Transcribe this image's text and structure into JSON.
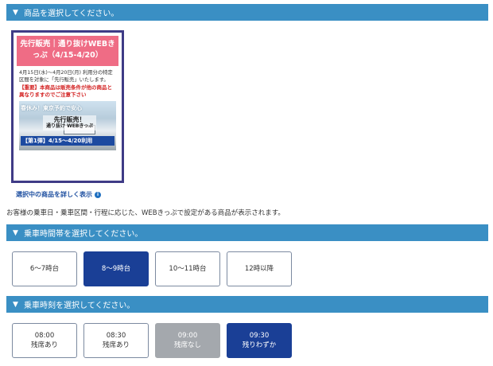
{
  "sections": {
    "product": "商品を選択してください。",
    "time_band": "乗車時間帯を選択してください。",
    "time": "乗車時刻を選択してください。"
  },
  "product_card": {
    "title": "先行販売｜通り抜けWEBきっぷ（4/15-4/20）",
    "description": "4月15日(水)～4月20日(月) 利用分の特定区間を対象に「先行販売」いたします。",
    "note": "【重要】本商品は販売条件が他の商品と異なりますのでご注意下さい",
    "image_overlay_top": "春休み！東京予約で安心",
    "image_overlay_main": "先行販売！",
    "image_overlay_sub": "通り抜け WEBきっぷ",
    "image_overlay_bottom": "【第1弾】4/15～4/20利用"
  },
  "detail_link": "選択中の商品を詳しく表示",
  "info_text": "お客様の乗車日・乗車区間・行程に応じた、WEBきっぷで設定がある商品が表示されます。",
  "time_bands": [
    {
      "label": "6〜7時台",
      "state": "normal"
    },
    {
      "label": "8〜9時台",
      "state": "selected"
    },
    {
      "label": "10〜11時台",
      "state": "normal"
    },
    {
      "label": "12時以降",
      "state": "normal"
    }
  ],
  "times": [
    {
      "time": "08:00",
      "status": "残席あり",
      "state": "normal"
    },
    {
      "time": "08:30",
      "status": "残席あり",
      "state": "normal"
    },
    {
      "time": "09:00",
      "status": "残席なし",
      "state": "disabled"
    },
    {
      "time": "09:30",
      "status": "残りわずか",
      "state": "selected"
    }
  ],
  "colors": {
    "section_bar": "#3a8fc4",
    "selected": "#1a3f96",
    "disabled": "#a4a8ad",
    "card_header": "#ef6c85",
    "card_border": "#3f3b86",
    "warning": "#d21e1e"
  }
}
